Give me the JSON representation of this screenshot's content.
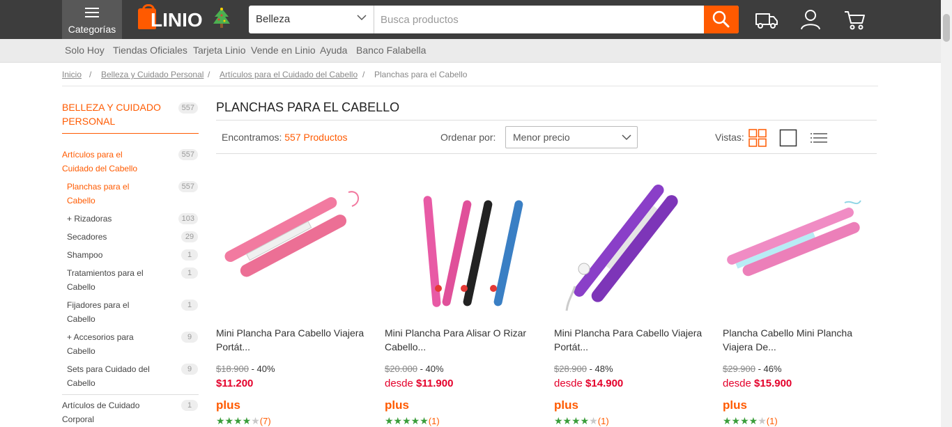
{
  "header": {
    "categories_label": "Categorías",
    "logo_text": "LINIO",
    "search_category": "Belleza",
    "search_placeholder": "Busca productos"
  },
  "subnav": [
    "Solo Hoy",
    "Tiendas Oficiales",
    "Tarjeta Linio",
    "Vende en Linio",
    "Ayuda",
    "Banco Falabella"
  ],
  "breadcrumb": [
    "Inicio",
    "Belleza y Cuidado Personal",
    "Artículos para el Cuidado del Cabello",
    "Planchas para el Cabello"
  ],
  "sidebar": {
    "title": "BELLEZA Y CUIDADO PERSONAL",
    "title_count": "557",
    "items": [
      {
        "label": "Artículos para el Cuidado del Cabello",
        "count": "557"
      },
      {
        "label": "Planchas para el Cabello",
        "count": "557"
      },
      {
        "label": "+ Rizadoras",
        "count": "103"
      },
      {
        "label": "Secadores",
        "count": "29"
      },
      {
        "label": "Shampoo",
        "count": "1"
      },
      {
        "label": "Tratamientos para el Cabello",
        "count": "1"
      },
      {
        "label": "Fijadores para el Cabello",
        "count": "1"
      },
      {
        "label": "+ Accesorios para Cabello",
        "count": "9"
      },
      {
        "label": "Sets para Cuidado del Cabello",
        "count": "9"
      },
      {
        "label": "Artículos de Cuidado Corporal",
        "count": "1"
      }
    ]
  },
  "main": {
    "title": "PLANCHAS PARA EL CABELLO",
    "found_label": "Encontramos:",
    "found_count": "557 Productos",
    "sort_label": "Ordenar por:",
    "sort_value": "Menor precio",
    "views_label": "Vistas:"
  },
  "products": [
    {
      "name": "Mini Plancha Para Cabello Viajera Portát...",
      "old_price": "$18.900",
      "discount": " - 40%",
      "from": "",
      "price": "$11.200",
      "plus": "plus",
      "rating": 4,
      "reviews": "(7)",
      "color": "#f27aa0"
    },
    {
      "name": "Mini Plancha Para Alisar O Rizar Cabello...",
      "old_price": "$20.000",
      "discount": " - 40%",
      "from": "desde ",
      "price": "$11.900",
      "plus": "plus",
      "rating": 5,
      "reviews": "(1)",
      "color": "#e0509a"
    },
    {
      "name": "Mini Plancha Para Cabello Viajera Portát...",
      "old_price": "$28.900",
      "discount": " - 48%",
      "from": "desde ",
      "price": "$14.900",
      "plus": "plus",
      "rating": 4,
      "reviews": "(1)",
      "color": "#8a3fc8"
    },
    {
      "name": "Plancha Cabello Mini Plancha Viajera De...",
      "old_price": "$29.900",
      "discount": " - 46%",
      "from": "desde ",
      "price": "$15.900",
      "plus": "plus",
      "rating": 4,
      "reviews": "(1)",
      "color": "#f08cc4"
    }
  ],
  "colors": {
    "brand": "#ff5a00",
    "topbar": "#3d3d3d",
    "price": "#e4002b",
    "star": "#3a9d3a"
  }
}
